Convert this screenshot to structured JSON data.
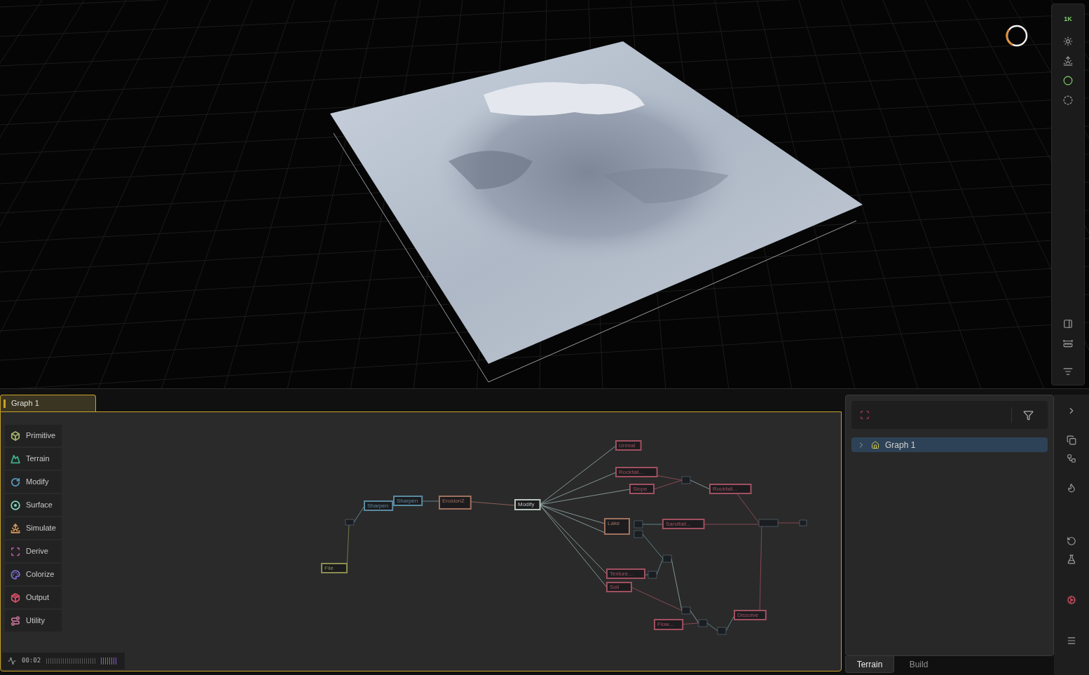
{
  "viewport_toolbar": {
    "resolution": "1K"
  },
  "graph_tabs": [
    {
      "label": "Graph 1",
      "selected": true
    }
  ],
  "palette": [
    {
      "label": "Primitive",
      "color": "#a3b46a",
      "kind": "cube"
    },
    {
      "label": "Terrain",
      "color": "#3fae8c",
      "kind": "mountain"
    },
    {
      "label": "Modify",
      "color": "#5b9bc4",
      "kind": "rotate"
    },
    {
      "label": "Surface",
      "color": "#7fd8c0",
      "kind": "disc"
    },
    {
      "label": "Simulate",
      "color": "#d99a5a",
      "kind": "sun"
    },
    {
      "label": "Derive",
      "color": "#b0569a",
      "kind": "scan"
    },
    {
      "label": "Colorize",
      "color": "#7a6ad0",
      "kind": "palette"
    },
    {
      "label": "Output",
      "color": "#d8506a",
      "kind": "package"
    },
    {
      "label": "Utility",
      "color": "#c07090",
      "kind": "route"
    }
  ],
  "nodes": [
    {
      "label": "File",
      "color": "#8c8c52"
    },
    {
      "label": "Sharpen",
      "color": "#5a8aa0"
    },
    {
      "label": "Sharpen",
      "color": "#5a8aa0"
    },
    {
      "label": "Erosion2",
      "color": "#a07060"
    },
    {
      "label": "Modify",
      "color": "#b8c4bc"
    },
    {
      "label": "Unreal",
      "color": "#a05060"
    },
    {
      "label": "Rockfall...",
      "color": "#a05060"
    },
    {
      "label": "Slope",
      "color": "#a05060"
    },
    {
      "label": "Rockfall...",
      "color": "#a05060"
    },
    {
      "label": "Lake",
      "color": "#a07060"
    },
    {
      "label": "Sandfall...",
      "color": "#a05060"
    },
    {
      "label": "Texture...",
      "color": "#a05060"
    },
    {
      "label": "Soil",
      "color": "#a05060"
    },
    {
      "label": "Flow...",
      "color": "#a05060"
    },
    {
      "label": "Dissolve",
      "color": "#a05060"
    }
  ],
  "status": {
    "time": "00:02"
  },
  "tree": [
    {
      "label": "Graph 1",
      "selected": true,
      "expanded": false
    }
  ],
  "bottom_tabs": [
    {
      "label": "Terrain",
      "selected": true
    },
    {
      "label": "Build",
      "selected": false
    }
  ]
}
